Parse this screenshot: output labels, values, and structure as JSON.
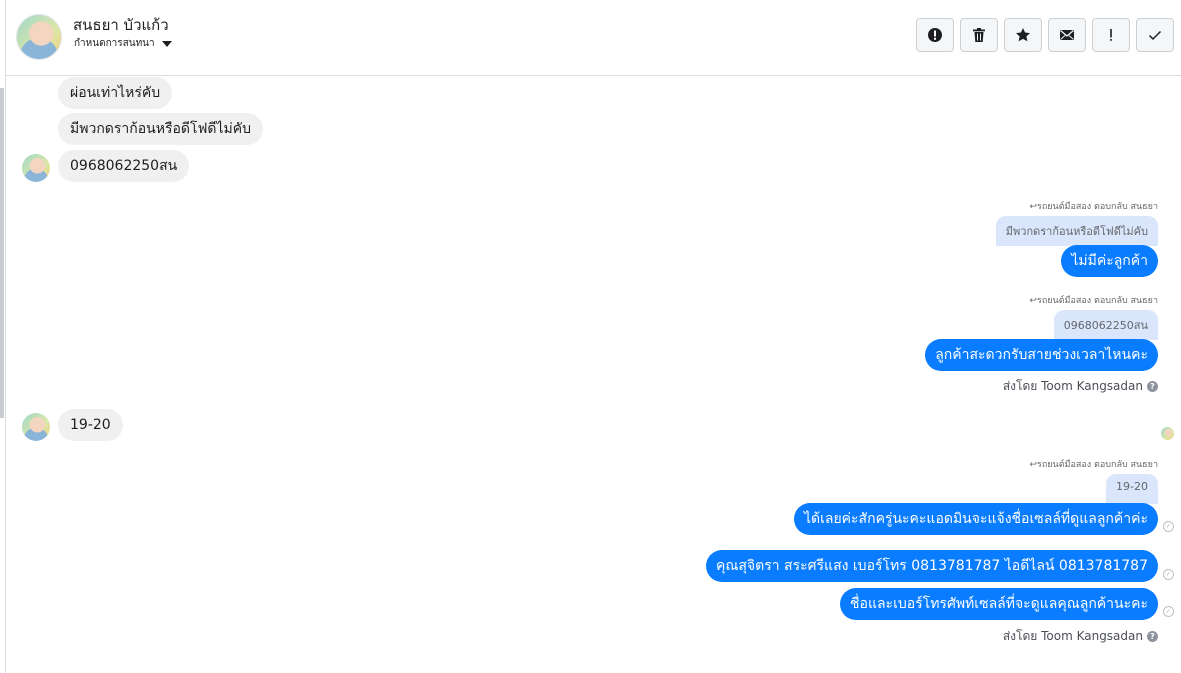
{
  "header": {
    "contact_name": "สนธยา บัวแก้ว",
    "assign_label": "กำหนดการสนทนา",
    "tools": [
      {
        "icon": "alert-circle-icon"
      },
      {
        "icon": "trash-icon"
      },
      {
        "icon": "star-icon"
      },
      {
        "icon": "envelope-icon"
      },
      {
        "icon": "exclamation-icon"
      },
      {
        "icon": "checkmark-icon"
      }
    ]
  },
  "messages": {
    "incoming_1": "ผ่อนเท่าไหร่คับ",
    "incoming_2": "มีพวกดราก้อนหรือดีโฟดีไม่คับ",
    "incoming_3": "0968062250สน",
    "reply_note": "รถยนต์มือสอง ตอบกลับ สนธยา",
    "quote_1": "มีพวกดราก้อนหรือดีโฟดีไม่คับ",
    "outgoing_1": "ไม่มีค่ะลูกค้า",
    "quote_2": "0968062250สน",
    "outgoing_2": "ลูกค้าสะดวกรับสายช่วงเวลาไหนคะ",
    "sent_by": "ส่งโดย Toom Kangsadan",
    "incoming_4": "19-20",
    "quote_3": "19-20",
    "outgoing_3": "ได้เลยค่ะสักครู่นะคะแอดมินจะแจ้งชื่อเซลล์ที่ดูแลลูกค้าค่ะ",
    "outgoing_4": "คุณสุจิตรา สระศรีแสง     เบอร์โทร 0813781787  ไอดีไลน์ 0813781787",
    "outgoing_5": "ชื่อและเบอร์โทรศัพท์เซลล์ที่จะดูแลคุณลูกค้านะคะ"
  },
  "colors": {
    "outgoing_bubble": "#0a7cff",
    "incoming_bubble": "#f0f0f0",
    "quote_bubble": "#d9e6fb"
  }
}
